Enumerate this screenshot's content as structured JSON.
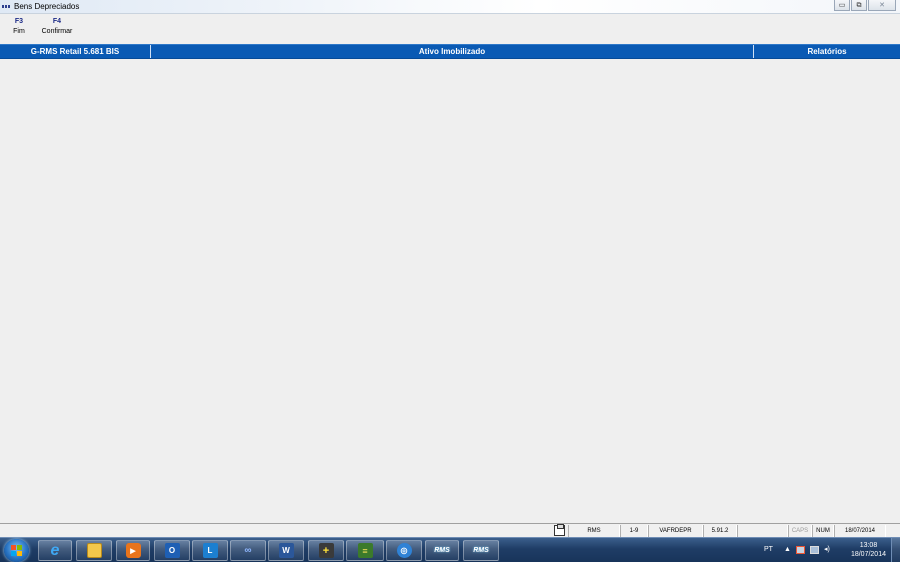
{
  "window": {
    "title": "Bens Depreciados",
    "controls": {
      "minimize": "▭",
      "restore": "⧉",
      "close": "✕"
    }
  },
  "function_keys": [
    {
      "code": "F3",
      "label": "Fim"
    },
    {
      "code": "F4",
      "label": "Confirmar"
    }
  ],
  "header": {
    "system": "G-RMS Retail 5.681 BIS",
    "module": "Ativo Imobilizado",
    "section": "Relatórios",
    "color": "#0a5ab4"
  },
  "statusbar": {
    "user": "RMS",
    "range": "1-9",
    "program": "VAFRDEPR",
    "version": "5.91.2",
    "empty": "",
    "caps": "CAPS",
    "num": "NUM",
    "date": "18/07/2014"
  },
  "taskbar": {
    "items": [
      {
        "icon": "internet-explorer-icon"
      },
      {
        "icon": "file-explorer-icon"
      },
      {
        "icon": "media-player-icon"
      },
      {
        "icon": "outlook-icon",
        "text": "O"
      },
      {
        "icon": "lync-icon",
        "text": "L"
      },
      {
        "icon": "remote-link-icon"
      },
      {
        "icon": "word-icon",
        "text": "W"
      },
      {
        "icon": "add-database-icon"
      },
      {
        "icon": "database-icon"
      },
      {
        "icon": "globe-icon"
      },
      {
        "icon": "rms-app-icon",
        "text": "RMS"
      },
      {
        "icon": "rms-app-icon-2",
        "text": "RMS"
      }
    ],
    "tray": {
      "language": "PT",
      "time": "13:08",
      "date": "18/07/2014"
    }
  }
}
